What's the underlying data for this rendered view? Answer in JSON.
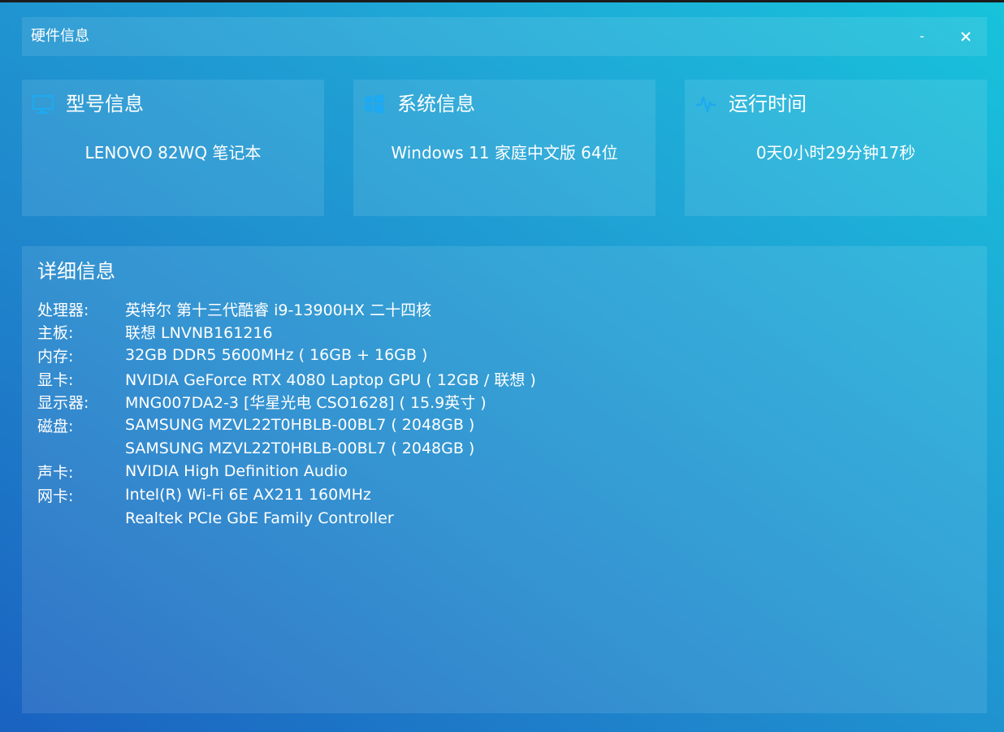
{
  "window": {
    "title": "硬件信息",
    "minimize_label": "-"
  },
  "cards": {
    "model": {
      "title": "型号信息",
      "value": "LENOVO 82WQ 笔记本",
      "icon": "monitor-icon"
    },
    "system": {
      "title": "系统信息",
      "value": "Windows 11 家庭中文版 64位",
      "icon": "windows-logo-icon"
    },
    "uptime": {
      "title": "运行时间",
      "value": "0天0小时29分钟17秒",
      "icon": "pulse-icon"
    }
  },
  "detail": {
    "title": "详细信息",
    "rows": [
      {
        "label": "处理器:",
        "value": "英特尔 第十三代酷睿 i9-13900HX 二十四核"
      },
      {
        "label": "主板:",
        "value": "联想 LNVNB161216"
      },
      {
        "label": "内存:",
        "value": "32GB DDR5 5600MHz ( 16GB + 16GB )"
      },
      {
        "label": "显卡:",
        "value": "NVIDIA GeForce RTX 4080 Laptop GPU ( 12GB / 联想 )"
      },
      {
        "label": "显示器:",
        "value": "MNG007DA2-3 [华星光电 CSO1628] ( 15.9英寸 )"
      },
      {
        "label": "磁盘:",
        "value": "SAMSUNG MZVL22T0HBLB-00BL7 ( 2048GB )"
      },
      {
        "label": "",
        "value": "SAMSUNG MZVL22T0HBLB-00BL7 ( 2048GB )"
      },
      {
        "label": "声卡:",
        "value": "NVIDIA High Definition Audio"
      },
      {
        "label": "网卡:",
        "value": "Intel(R) Wi-Fi 6E AX211 160MHz"
      },
      {
        "label": "",
        "value": "Realtek PCIe GbE Family Controller"
      }
    ]
  },
  "colors": {
    "accent_icon": "#1ea9f0",
    "text": "#ffffff"
  }
}
